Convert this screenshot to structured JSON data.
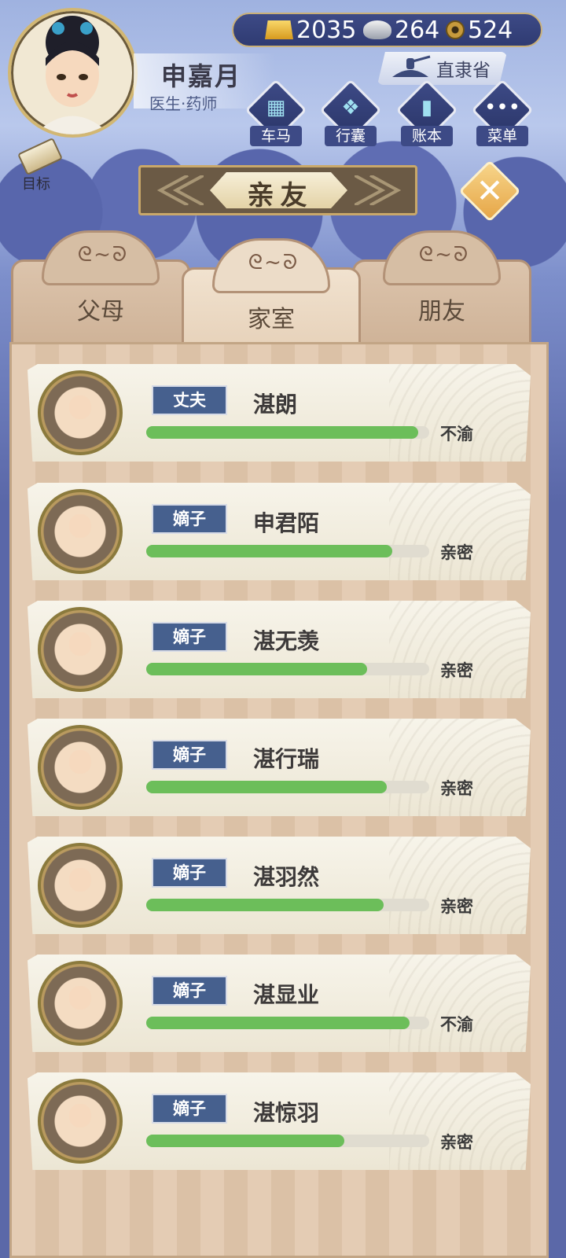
{
  "player": {
    "name": "申嘉月",
    "title": "医生·药师"
  },
  "currency": {
    "gold": "2035",
    "silver": "264",
    "copper": "524"
  },
  "location": {
    "province": "直隶省"
  },
  "menu": [
    {
      "label": "车马",
      "icon": "carriage-icon"
    },
    {
      "label": "行囊",
      "icon": "bag-icon"
    },
    {
      "label": "账本",
      "icon": "ledger-icon"
    },
    {
      "label": "菜单",
      "icon": "more-icon"
    }
  ],
  "goal": {
    "label": "目标"
  },
  "page": {
    "title": "亲友"
  },
  "tabs": [
    {
      "label": "父母",
      "active": false
    },
    {
      "label": "家室",
      "active": true
    },
    {
      "label": "朋友",
      "active": false
    }
  ],
  "members": [
    {
      "role": "丈夫",
      "name": "湛朗",
      "status": "不渝",
      "affection": 0.96
    },
    {
      "role": "嫡子",
      "name": "申君陌",
      "status": "亲密",
      "affection": 0.87
    },
    {
      "role": "嫡子",
      "name": "湛无羡",
      "status": "亲密",
      "affection": 0.78
    },
    {
      "role": "嫡子",
      "name": "湛行瑞",
      "status": "亲密",
      "affection": 0.85
    },
    {
      "role": "嫡子",
      "name": "湛羽然",
      "status": "亲密",
      "affection": 0.84
    },
    {
      "role": "嫡子",
      "name": "湛显业",
      "status": "不渝",
      "affection": 0.93
    },
    {
      "role": "嫡子",
      "name": "湛惊羽",
      "status": "亲密",
      "affection": 0.7
    }
  ]
}
